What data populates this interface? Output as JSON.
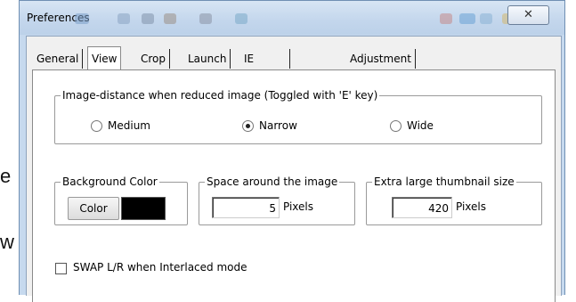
{
  "background_letters": [
    "e",
    "w"
  ],
  "window": {
    "title": "Preferences",
    "close_glyph": "✕",
    "accent": "#c6d9ee"
  },
  "tabs": [
    {
      "label": "General",
      "active": false
    },
    {
      "label": "View",
      "active": true
    },
    {
      "label": "Crop",
      "active": false
    },
    {
      "label": "Launch",
      "active": false
    },
    {
      "label": "IE Context Menu",
      "active": false
    },
    {
      "label": "Adjustment",
      "active": false
    }
  ],
  "image_distance": {
    "legend": "Image-distance when reduced image (Toggled with 'E' key)",
    "options": [
      {
        "label": "Medium",
        "selected": false
      },
      {
        "label": "Narrow",
        "selected": true
      },
      {
        "label": "Wide",
        "selected": false
      }
    ]
  },
  "background_color": {
    "legend": "Background Color",
    "button_label": "Color",
    "swatch_color": "#000000"
  },
  "space_around": {
    "legend": "Space around the image",
    "value": "5",
    "unit": "Pixels"
  },
  "thumbnail_size": {
    "legend": "Extra large thumbnail size",
    "value": "420",
    "unit": "Pixels"
  },
  "swap_option": {
    "label": "SWAP L/R when Interlaced mode",
    "checked": false
  }
}
